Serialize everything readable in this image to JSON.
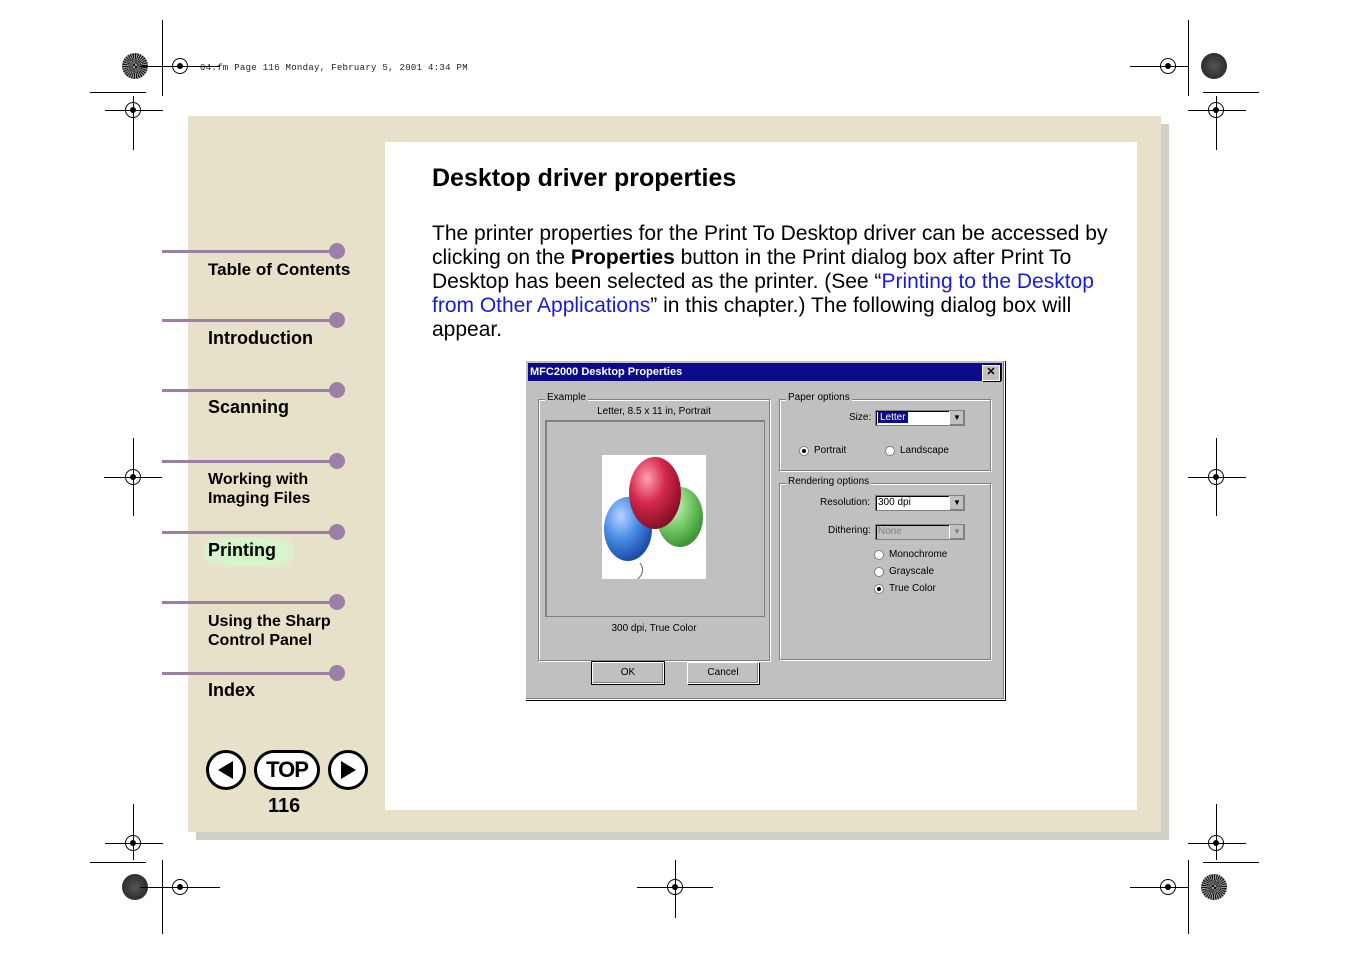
{
  "header_stamp": "04.fm  Page 116  Monday, February 5, 2001  4:34 PM",
  "nav": {
    "items": [
      {
        "label": "Table of Contents"
      },
      {
        "label": "Introduction"
      },
      {
        "label": "Scanning"
      },
      {
        "label_line1": "Working with",
        "label_line2": "Imaging Files"
      },
      {
        "label": "Printing",
        "active": true
      },
      {
        "label_line1": "Using the Sharp",
        "label_line2": "Control Panel"
      },
      {
        "label": "Index"
      }
    ],
    "top_label": "TOP",
    "prev_icon": "left-arrow-icon",
    "next_icon": "right-arrow-icon",
    "page_number": "116",
    "accent_color": "#9b7fa6"
  },
  "content": {
    "title": "Desktop driver properties",
    "para_part1": "The printer properties for the Print To Desktop driver can be accessed by clicking on the ",
    "para_bold": "Properties",
    "para_part2": " button in the Print dialog box after Print To Desktop has been selected as the printer. (See “",
    "para_link": "Printing to the Desktop from Other Applications",
    "para_part3": "” in this chapter.) The following dialog box will appear."
  },
  "dialog": {
    "title": "MFC2000 Desktop Properties",
    "close": "✕",
    "example": {
      "legend": "Example",
      "caption_top": "Letter, 8.5 x 11 in, Portrait",
      "caption_bottom": "300 dpi, True Color"
    },
    "paper_options": {
      "legend": "Paper options",
      "size_label": "Size:",
      "size_value": "Letter",
      "portrait": "Portrait",
      "landscape": "Landscape",
      "selected": "Portrait"
    },
    "rendering_options": {
      "legend": "Rendering options",
      "resolution_label": "Resolution:",
      "resolution_value": "300 dpi",
      "dithering_label": "Dithering:",
      "dithering_value": "None",
      "monochrome": "Monochrome",
      "grayscale": "Grayscale",
      "true_color": "True Color",
      "selected": "True Color"
    },
    "ok": "OK",
    "cancel": "Cancel"
  }
}
